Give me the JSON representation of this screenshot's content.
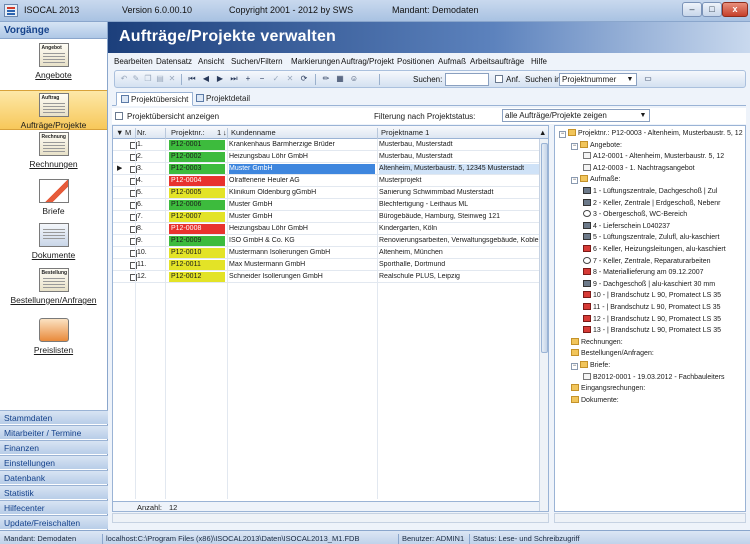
{
  "window": {
    "app_name": "ISOCAL 2013",
    "version": "Version 6.0.00.10",
    "copyright": "Copyright 2001 - 2012 by SWS",
    "mandant": "Mandant: Demodaten",
    "minimize": "–",
    "maximize": "□",
    "close": "x"
  },
  "nav": {
    "header": "Vorgänge",
    "items": [
      {
        "label": "Angebote",
        "tag": "Angebot"
      },
      {
        "label": "Aufträge/Projekte",
        "tag": "Auftrag"
      },
      {
        "label": "Rechnungen",
        "tag": "Rechnung"
      },
      {
        "label": "Briefe",
        "tag": ""
      },
      {
        "label": "Dokumente",
        "tag": ""
      },
      {
        "label": "Bestellungen/Anfragen",
        "tag": "Bestellung"
      },
      {
        "label": "Preislisten",
        "tag": ""
      }
    ],
    "sections": [
      "Stammdaten",
      "Mitarbeiter / Termine",
      "Finanzen",
      "Einstellungen",
      "Datenbank",
      "Statistik",
      "Hilfecenter",
      "Update/Freischalten"
    ]
  },
  "main": {
    "title": "Aufträge/Projekte verwalten",
    "menu": [
      "Bearbeiten",
      "Datensatz",
      "Ansicht",
      "Suchen/Filtern",
      "Markierungen",
      "Auftrag/Projekt",
      "Positionen",
      "Aufmaß",
      "Arbeitsaufträge",
      "Hilfe"
    ],
    "toolbar": {
      "search_label": "Suchen:",
      "search_value": "",
      "anf_label": "Anf.",
      "search_in_label": "Suchen in:",
      "search_in_value": "Projektnummer"
    },
    "tabs": [
      "Projektübersicht",
      "Projektdetail"
    ],
    "filter": {
      "show_overview_label": "Projektübersicht anzeigen",
      "status_label": "Filterung nach Projektstatus:",
      "status_value": "alle Aufträge/Projekte zeigen"
    }
  },
  "grid": {
    "headers": {
      "m": "M",
      "nr": "Nr.",
      "projektnr": "Projektnr.:",
      "sort": "1",
      "kunde": "Kundenname",
      "projekt": "Projektname 1"
    },
    "rows": [
      {
        "nr": "1.",
        "pnr": "P12-0001",
        "color": "#3dbb3d",
        "kunde": "Krankenhaus Barmherzige Brüder",
        "projekt": "Musterbau, Musterstadt"
      },
      {
        "nr": "2.",
        "pnr": "P12-0002",
        "color": "#3dbb3d",
        "kunde": "Heizungsbau Löhr GmbH",
        "projekt": "Musterbau, Musterstadt"
      },
      {
        "nr": "3.",
        "pnr": "P12-0003",
        "color": "#3dbb3d",
        "kunde": "Muster GmbH",
        "projekt": "Altenheim, Musterbaustr. 5, 12345 Musterstadt"
      },
      {
        "nr": "4.",
        "pnr": "P12-0004",
        "color": "#e8322e",
        "kunde": "Ölraffenerie Heuler AG",
        "projekt": "Musterprojekt"
      },
      {
        "nr": "5.",
        "pnr": "P12-0005",
        "color": "#e3e327",
        "kunde": "Klinikum Oldenburg gGmbH",
        "projekt": "Sanierung Schwimmbad Musterstadt"
      },
      {
        "nr": "6.",
        "pnr": "P12-0006",
        "color": "#3dbb3d",
        "kunde": "Muster GmbH",
        "projekt": "Blechfertigung - Leithaus ML"
      },
      {
        "nr": "7.",
        "pnr": "P12-0007",
        "color": "#e3e327",
        "kunde": "Muster GmbH",
        "projekt": "Bürogebäude, Hamburg, Steinweg 121"
      },
      {
        "nr": "8.",
        "pnr": "P12-0008",
        "color": "#e8322e",
        "kunde": "Heizungsbau Löhr GmbH",
        "projekt": "Kindergarten, Köln"
      },
      {
        "nr": "9.",
        "pnr": "P12-0009",
        "color": "#3dbb3d",
        "kunde": "ISO GmbH & Co. KG",
        "projekt": "Renovierungsarbeiten, Verwaltungsgebäude, Koblenz"
      },
      {
        "nr": "10.",
        "pnr": "P12-0010",
        "color": "#e3e327",
        "kunde": "Mustermann Isolierungen GmbH",
        "projekt": "Altenheim, München"
      },
      {
        "nr": "11.",
        "pnr": "P12-0011",
        "color": "#e3e327",
        "kunde": "Max Mustermann GmbH",
        "projekt": "Sporthalle, Dortmund"
      },
      {
        "nr": "12.",
        "pnr": "P12-0012",
        "color": "#e3e327",
        "kunde": "Schneider Isollerungen GmbH",
        "projekt": "Realschule PLUS, Leipzig"
      }
    ],
    "footer_label": "Anzahl:",
    "footer_count": "12"
  },
  "tree": {
    "nodes": [
      {
        "text": "Projektnr.: P12-0003 - Altenheim, Musterbaustr. 5, 12",
        "icon": "folder",
        "level": 0,
        "exp": "−"
      },
      {
        "text": "Angebote:",
        "icon": "folder",
        "level": 1,
        "exp": "−"
      },
      {
        "text": "A12-0001 - Altenheim, Musterbaustr. 5, 12",
        "icon": "doc",
        "level": 2,
        "exp": ""
      },
      {
        "text": "A12-0003 - 1. Nachtragsangebot",
        "icon": "doc",
        "level": 2,
        "exp": ""
      },
      {
        "text": "Aufmaße:",
        "icon": "folder",
        "level": 1,
        "exp": "−"
      },
      {
        "text": "1 - Lüftungszentrale, Dachgeschoß | Zul",
        "icon": "cube",
        "level": 2,
        "exp": ""
      },
      {
        "text": "2 - Keller, Zentrale | Erdgeschoß, Nebenr",
        "icon": "cube",
        "level": 2,
        "exp": ""
      },
      {
        "text": "3 - Obergeschoß, WC-Bereich",
        "icon": "gear",
        "level": 2,
        "exp": ""
      },
      {
        "text": "4 - Lieferschein L040237",
        "icon": "cube",
        "level": 2,
        "exp": ""
      },
      {
        "text": "5 - Lüftungszentrale, Zulufl, alu-kaschiert",
        "icon": "cube",
        "level": 2,
        "exp": ""
      },
      {
        "text": "6 - Keller, Heizungsleitungen, alu-kaschiert",
        "icon": "red",
        "level": 2,
        "exp": ""
      },
      {
        "text": "7 - Keller, Zentrale, Reparaturarbeiten",
        "icon": "gear",
        "level": 2,
        "exp": ""
      },
      {
        "text": "8 - Materiallieferung am 09.12.2007",
        "icon": "red",
        "level": 2,
        "exp": ""
      },
      {
        "text": "9 - Dachgeschoß | alu-kaschiert 30 mm",
        "icon": "cube",
        "level": 2,
        "exp": ""
      },
      {
        "text": "10 - | Brandschutz L 90, Promatect LS 35",
        "icon": "red",
        "level": 2,
        "exp": ""
      },
      {
        "text": "11 - | Brandschutz L 90, Promatect LS 35",
        "icon": "red",
        "level": 2,
        "exp": ""
      },
      {
        "text": "12 - | Brandschutz L 90, Promatect LS 35",
        "icon": "red",
        "level": 2,
        "exp": ""
      },
      {
        "text": "13 - | Brandschutz L 90, Promatect LS 35",
        "icon": "red",
        "level": 2,
        "exp": ""
      },
      {
        "text": "Rechnungen:",
        "icon": "folder",
        "level": 1,
        "exp": ""
      },
      {
        "text": "Bestellungen/Anfragen:",
        "icon": "folder",
        "level": 1,
        "exp": ""
      },
      {
        "text": "Briefe:",
        "icon": "folder",
        "level": 1,
        "exp": "−"
      },
      {
        "text": "B2012-0001 - 19.03.2012 - Fachbauleiters",
        "icon": "doc",
        "level": 2,
        "exp": ""
      },
      {
        "text": "Eingangsrechungen:",
        "icon": "folder",
        "level": 1,
        "exp": ""
      },
      {
        "text": "Dokumente:",
        "icon": "folder",
        "level": 1,
        "exp": ""
      }
    ]
  },
  "status": {
    "mandant": "Mandant: Demodaten",
    "path": "localhost:C:\\Program Files (x86)\\ISOCAL2013\\Daten\\ISOCAL2013_M1.FDB",
    "user": "Benutzer: ADMIN1",
    "access": "Status: Lese- und Schreibzugriff"
  }
}
